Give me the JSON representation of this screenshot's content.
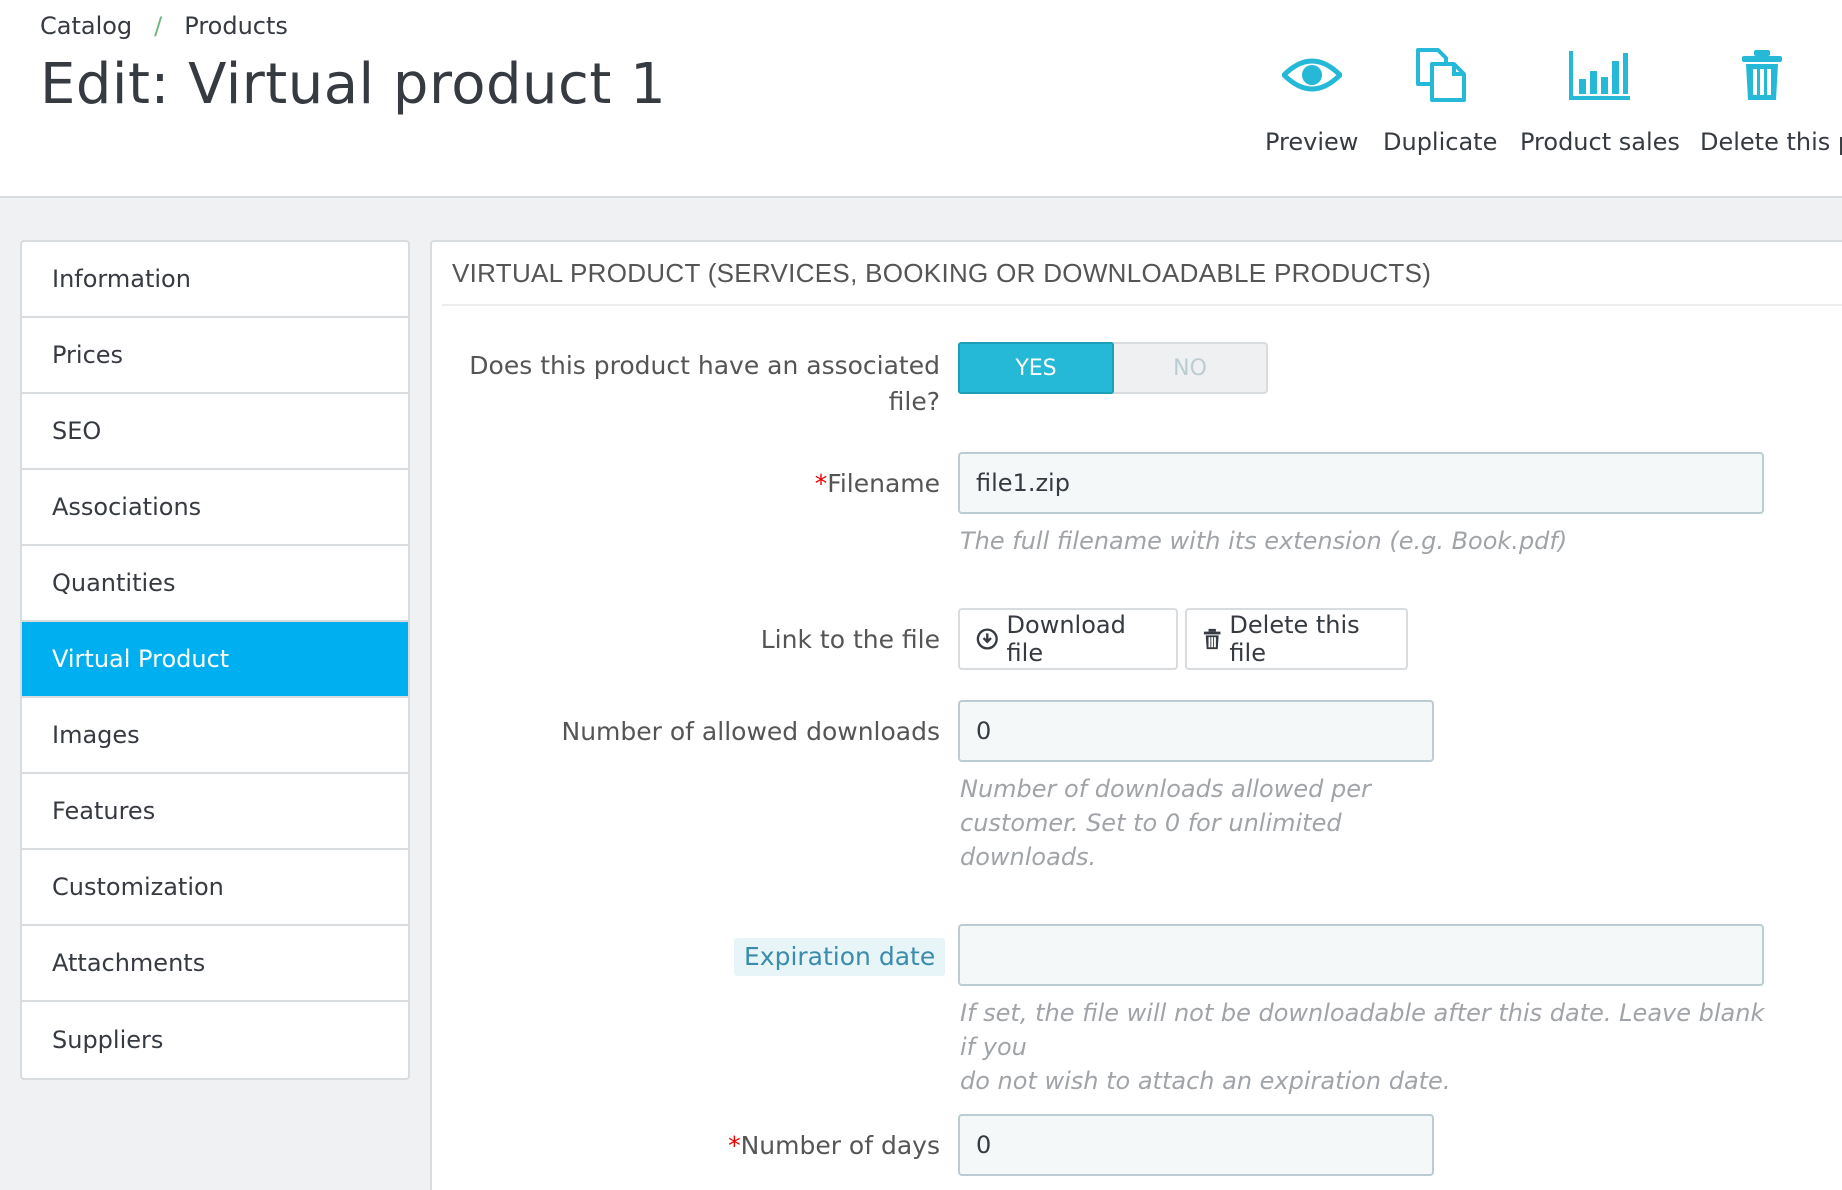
{
  "breadcrumb": {
    "items": [
      "Catalog",
      "Products"
    ],
    "separator": "/"
  },
  "page": {
    "title": "Edit: Virtual product 1"
  },
  "toolbar": {
    "preview": {
      "label": "Preview",
      "icon": "eye-icon"
    },
    "duplicate": {
      "label": "Duplicate",
      "icon": "duplicate-icon"
    },
    "sales": {
      "label": "Product sales",
      "icon": "bar-chart-icon"
    },
    "delete": {
      "label": "Delete this p",
      "icon": "trash-icon"
    }
  },
  "sidebar": {
    "items": [
      {
        "label": "Information"
      },
      {
        "label": "Prices"
      },
      {
        "label": "SEO"
      },
      {
        "label": "Associations"
      },
      {
        "label": "Quantities"
      },
      {
        "label": "Virtual Product",
        "active": true
      },
      {
        "label": "Images"
      },
      {
        "label": "Features"
      },
      {
        "label": "Customization"
      },
      {
        "label": "Attachments"
      },
      {
        "label": "Suppliers"
      }
    ]
  },
  "panel": {
    "heading": "VIRTUAL PRODUCT (SERVICES, BOOKING OR DOWNLOADABLE PRODUCTS)",
    "associated_file": {
      "label_line1": "Does this product have an associated",
      "label_line2": "file?",
      "yes": "YES",
      "no": "NO",
      "selected": "YES"
    },
    "filename": {
      "required": "*",
      "label": "Filename",
      "value": "file1.zip",
      "help": "The full filename with its extension (e.g. Book.pdf)"
    },
    "link": {
      "label": "Link to the file",
      "download_label": "Download file",
      "delete_label": "Delete this file"
    },
    "downloads": {
      "label": "Number of allowed downloads",
      "value": "0",
      "help_line1": "Number of downloads allowed per",
      "help_line2": "customer. Set to 0 for unlimited",
      "help_line3": "downloads."
    },
    "expiration": {
      "label": "Expiration date",
      "value": "",
      "help_line1": "If set, the file will not be downloadable after this date. Leave blank if you",
      "help_line2": "do not wish to attach an expiration date."
    },
    "days": {
      "required": "*",
      "label": "Number of days",
      "value": "0"
    }
  },
  "colors": {
    "accent": "#25b9d7",
    "sidebar_active": "#00aff0",
    "breadcrumb_sep": "#70b580",
    "required": "#ee0000"
  }
}
